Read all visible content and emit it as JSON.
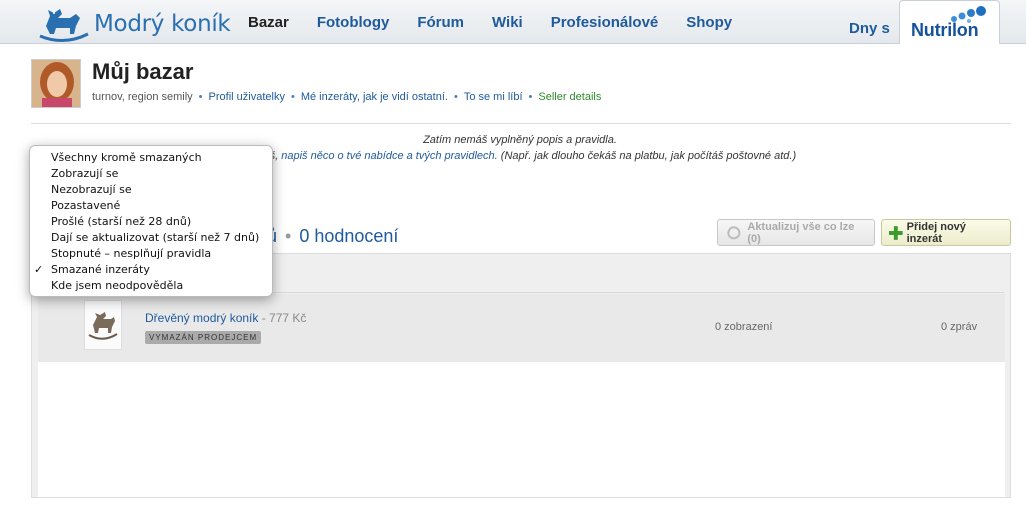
{
  "site": {
    "logo_text": "Modrý koník",
    "nav": [
      {
        "label": "Bazar",
        "active": true
      },
      {
        "label": "Fotoblogy"
      },
      {
        "label": "Fórum"
      },
      {
        "label": "Wiki"
      },
      {
        "label": "Profesionálové"
      },
      {
        "label": "Shopy"
      }
    ],
    "nav_extra": "Dny s",
    "sponsor": "Nutrilon"
  },
  "profile": {
    "title": "Můj bazar",
    "location": "turnov, region semily",
    "links": [
      "Profil uživatelky",
      "Mé inzeráty, jak je vidí ostatní.",
      "To se mi líbí",
      "Seller details"
    ]
  },
  "notes": {
    "line1": "Zatím nemáš vyplněný popis a pravidla.",
    "line2_prefix": "ceš,",
    "line2_link": "napiš něco o tvé nabídce a tvých pravidlech.",
    "line2_suffix": "(Např. jak dlouho čekáš na platbu, jak počítáš poštovné atd.)"
  },
  "stats": {
    "partial": "ců",
    "ratings": "0 hodnocení"
  },
  "buttons": {
    "refresh": "Aktualizuj vše co lze (0)",
    "add": "Přidej nový inzerát"
  },
  "listing": {
    "name": "Dřevěný modrý koník",
    "price": "- 777 Kč",
    "badge": "VYMAZÁN PRODEJCEM",
    "views": "0 zobrazení",
    "messages": "0 zpráv"
  },
  "filter_menu": {
    "items": [
      "Všechny kromě smazaných",
      "Zobrazují se",
      "Nezobrazují se",
      "Pozastavené",
      "Prošlé (starší než 28 dnů)",
      "Dají se aktualizovat (starší než 7 dnů)",
      "Stopnuté – nesplňují pravidla",
      "Smazané inzeráty",
      "Kde jsem neodpověděla"
    ],
    "selected": "Smazané inzeráty",
    "check_glyph": "✓"
  },
  "colors": {
    "link": "#1f5a9c",
    "green_link": "#2e8b2e",
    "logo": "#2a6fb0"
  }
}
